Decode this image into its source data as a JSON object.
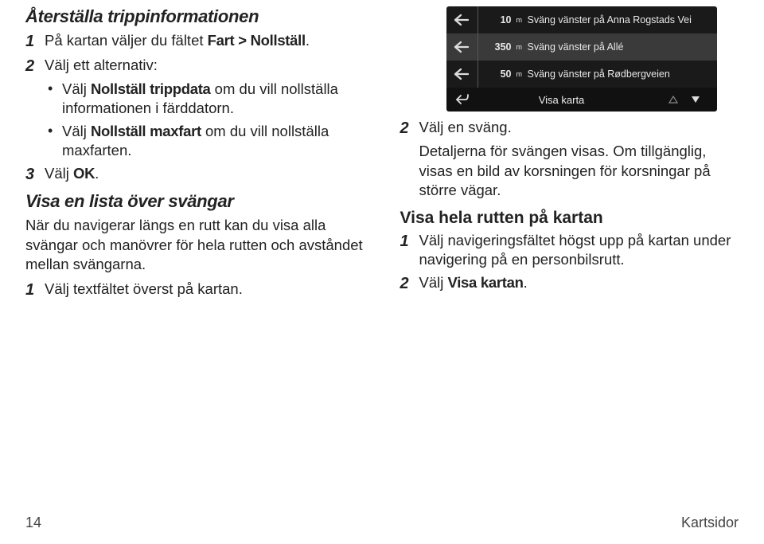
{
  "left": {
    "heading1": "Återställa trippinformationen",
    "step1_pre": "På kartan väljer du fältet ",
    "step1_bold": "Fart > Nollställ",
    "step1_post": ".",
    "step2": "Välj ett alternativ:",
    "bullet1_pre": "Välj ",
    "bullet1_bold": "Nollställ trippdata",
    "bullet1_post": " om du vill nollställa informationen i färddatorn.",
    "bullet2_pre": "Välj ",
    "bullet2_bold": "Nollställ maxfart",
    "bullet2_post": " om du vill nollställa maxfarten.",
    "step3_pre": "Välj ",
    "step3_bold": "OK",
    "step3_post": ".",
    "heading2": "Visa en lista över svängar",
    "para1": "När du navigerar längs en rutt kan du visa alla svängar och manövrer för hela rutten och avståndet mellan svängarna.",
    "step4": "Välj textfältet överst på kartan."
  },
  "device": {
    "rows": [
      {
        "dist": "10",
        "unit": "m",
        "text": "Sväng vänster på Anna Rogstads Vei"
      },
      {
        "dist": "350",
        "unit": "m",
        "text": "Sväng vänster på Allé"
      },
      {
        "dist": "50",
        "unit": "m",
        "text": "Sväng vänster på Rødbergveien"
      }
    ],
    "bottom_label": "Visa karta"
  },
  "right": {
    "step2": "Välj en sväng.",
    "para2": "Detaljerna för svängen visas. Om tillgänglig, visas en bild av korsningen för korsningar på större vägar.",
    "heading3": "Visa hela rutten på kartan",
    "step1r": "Välj navigeringsfältet högst upp på kartan under navigering på en personbilsrutt.",
    "step2r_pre": "Välj ",
    "step2r_bold": "Visa kartan",
    "step2r_post": "."
  },
  "footer": {
    "page": "14",
    "section": "Kartsidor"
  },
  "nums": {
    "n1": "1",
    "n2": "2",
    "n3": "3"
  }
}
